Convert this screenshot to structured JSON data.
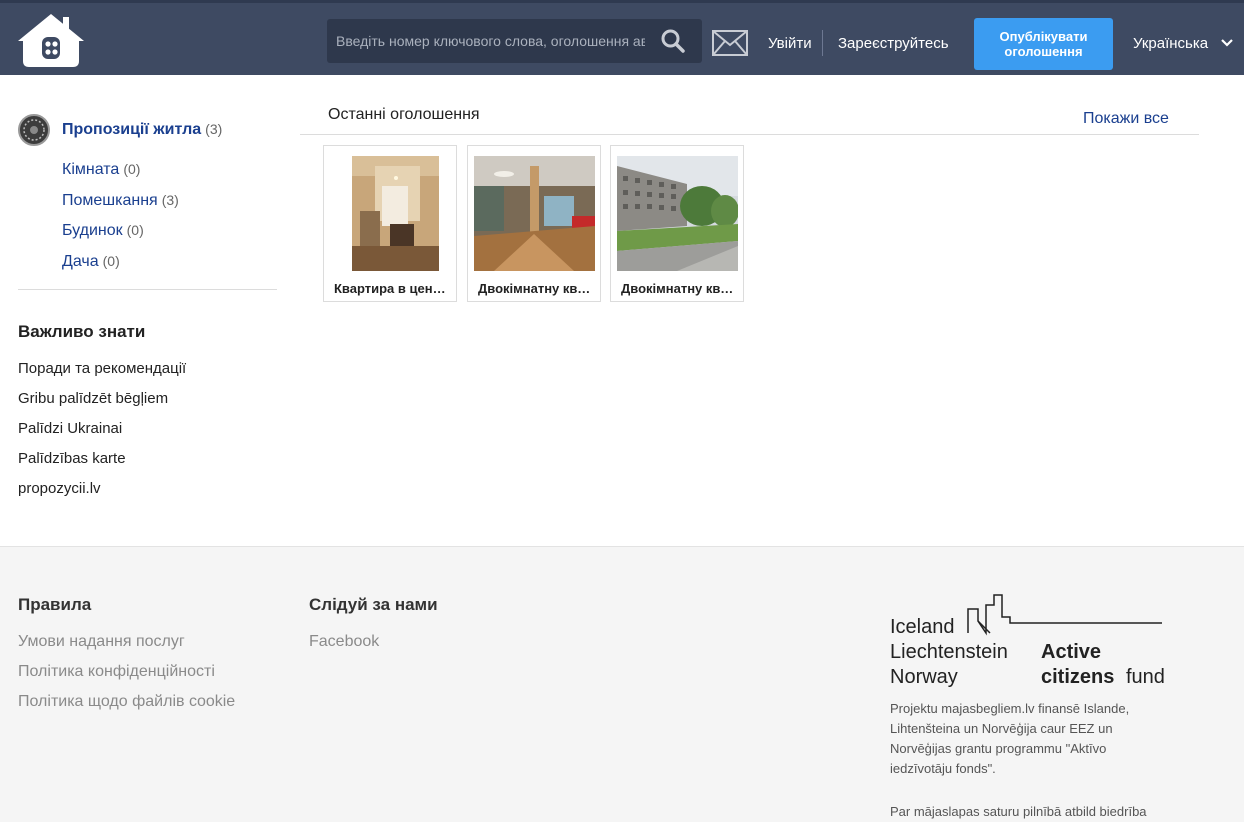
{
  "header": {
    "search_placeholder": "Введіть номер ключового слова, оголошення ав",
    "login": "Увійти",
    "register": "Зареєструйтесь",
    "publish_line1": "Опублікувати",
    "publish_line2": "оголошення",
    "language": "Українська"
  },
  "sidebar": {
    "category": {
      "label": "Пропозиції житла",
      "count": "(3)"
    },
    "subcategories": [
      {
        "label": "Кімната",
        "count": "(0)"
      },
      {
        "label": "Помешкання",
        "count": "(3)"
      },
      {
        "label": "Будинок",
        "count": "(0)"
      },
      {
        "label": "Дача",
        "count": "(0)"
      }
    ],
    "know_title": "Важливо знати",
    "know_links": [
      "Поради та рекомендації",
      "Gribu palīdzēt bēgļiem",
      "Palīdzi Ukrainai",
      "Palīdzības karte",
      "propozycii.lv"
    ]
  },
  "main": {
    "latest_title": "Останні оголошення",
    "show_all": "Покажи все",
    "listings": [
      {
        "title": "Квартира в центрі"
      },
      {
        "title": "Двокімнатну квартиру"
      },
      {
        "title": "Двокімнатну квартиру"
      }
    ]
  },
  "footer": {
    "rules_title": "Правила",
    "rules_links": [
      "Умови надання послуг",
      "Політика конфіденційності",
      "Політика щодо файлів cookie"
    ],
    "follow_title": "Слідуй за нами",
    "follow_links": [
      "Facebook"
    ],
    "eea_logo": {
      "countries": [
        "Iceland",
        "Liechtenstein",
        "Norway"
      ],
      "fund_bold_1": "Active",
      "fund_bold_2": "citizens",
      "fund_rest": "fund"
    },
    "funding_text": "Projektu majasbegliem.lv finansē Islande, Lihtenšteina un Norvēģija caur EEZ un Norvēģijas grantu programmu \"Aktīvo iedzīvotāju fonds\".",
    "responsibility_text": "Par mājaslapas saturu pilnībā atbild biedrība"
  }
}
